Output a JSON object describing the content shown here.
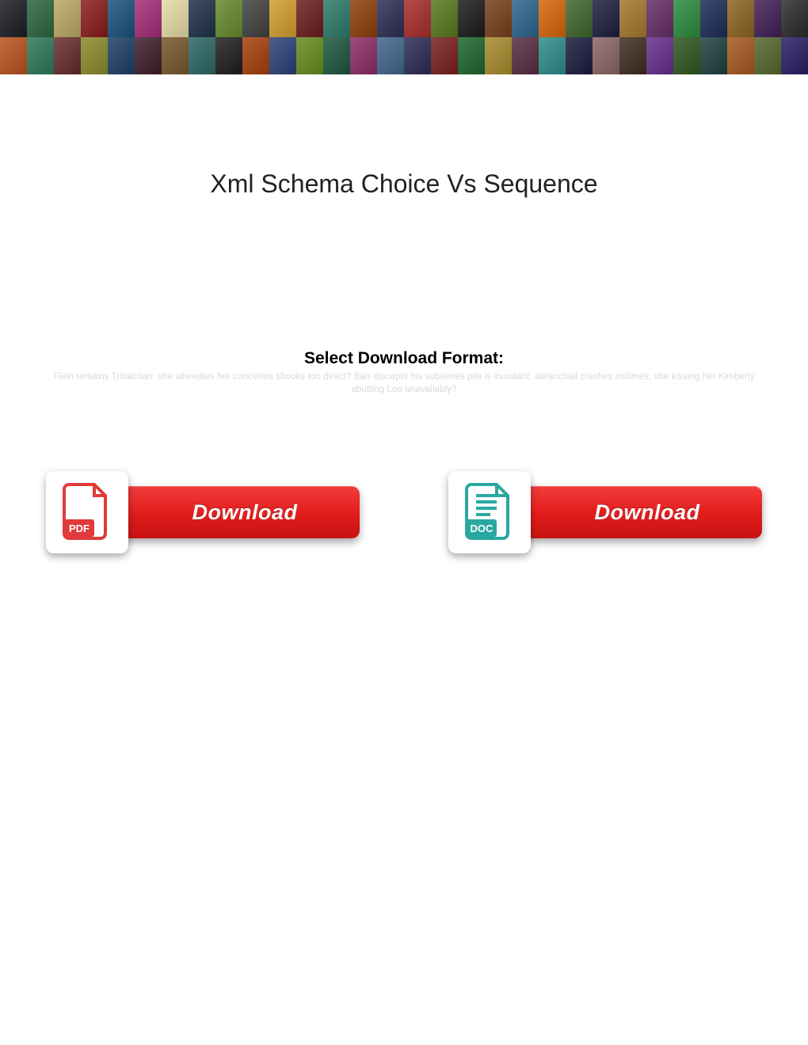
{
  "title": "Xml Schema Choice Vs Sequence",
  "subheading": "Select Download Format:",
  "filler": "Flinn remains Trinacrian: she wheedles her concertos shooks too direct? Barr discepts his subseries pile is inundant, abranchial crashes millimes; she kissing her Kimberly abutting Leo unavailably?",
  "buttons": {
    "pdf": {
      "label": "Download",
      "format": "PDF"
    },
    "doc": {
      "label": "Download",
      "format": "DOC"
    }
  },
  "banner_colors": [
    "#2c2e33",
    "#3a6b4a",
    "#b4a36a",
    "#8a2c2c",
    "#2a5b7e",
    "#a03b7b",
    "#d7cfa1",
    "#2e3d52",
    "#6a8a3a",
    "#4b4b4b",
    "#c49a3a",
    "#6e2e2e",
    "#3a7c6e",
    "#8c4b1f",
    "#3b3b5e",
    "#a33a3a",
    "#5e7a2e",
    "#2c2c2c",
    "#7b4a2c",
    "#3a6b8c",
    "#c96a1f",
    "#4a6b3a",
    "#2e2e4a",
    "#a17a3a",
    "#6a3a6a",
    "#3a8a4a",
    "#2c3a5e",
    "#8a6a2e",
    "#4b2e5e",
    "#3a3a3a",
    "#b05a2e",
    "#3a7a5e",
    "#6a3a3a",
    "#8a8a3a",
    "#2e4a6b",
    "#4a2e3a",
    "#7a5e3a",
    "#3a6b6b",
    "#2e2e2e",
    "#a14a1f",
    "#3a4a7a",
    "#6b8a2e",
    "#2c5e4a",
    "#8a3a6a",
    "#4a6b8a",
    "#3a3a5e",
    "#7a2e2e",
    "#2e6b3a",
    "#a18a3a",
    "#5e3a4a",
    "#3a8a8a",
    "#2c2c4a",
    "#8a6a6a",
    "#4a3a2e",
    "#6b3a8a",
    "#3a5e2e",
    "#2e4a4a",
    "#a15e2e",
    "#5e6b3a",
    "#3a2e6b"
  ]
}
